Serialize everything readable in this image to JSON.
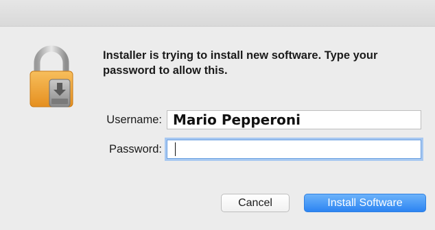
{
  "dialog": {
    "message": "Installer is trying to install new software. Type your password to allow this.",
    "icon": "lock-installer-icon"
  },
  "form": {
    "username_label": "Username:",
    "username_value": "Mario Pepperoni",
    "password_label": "Password:",
    "password_value": ""
  },
  "buttons": {
    "cancel_label": "Cancel",
    "install_label": "Install Software"
  },
  "colors": {
    "accent": "#2c84f2",
    "focus_ring": "#a7c8f1",
    "lock_orange": "#f0a236"
  }
}
